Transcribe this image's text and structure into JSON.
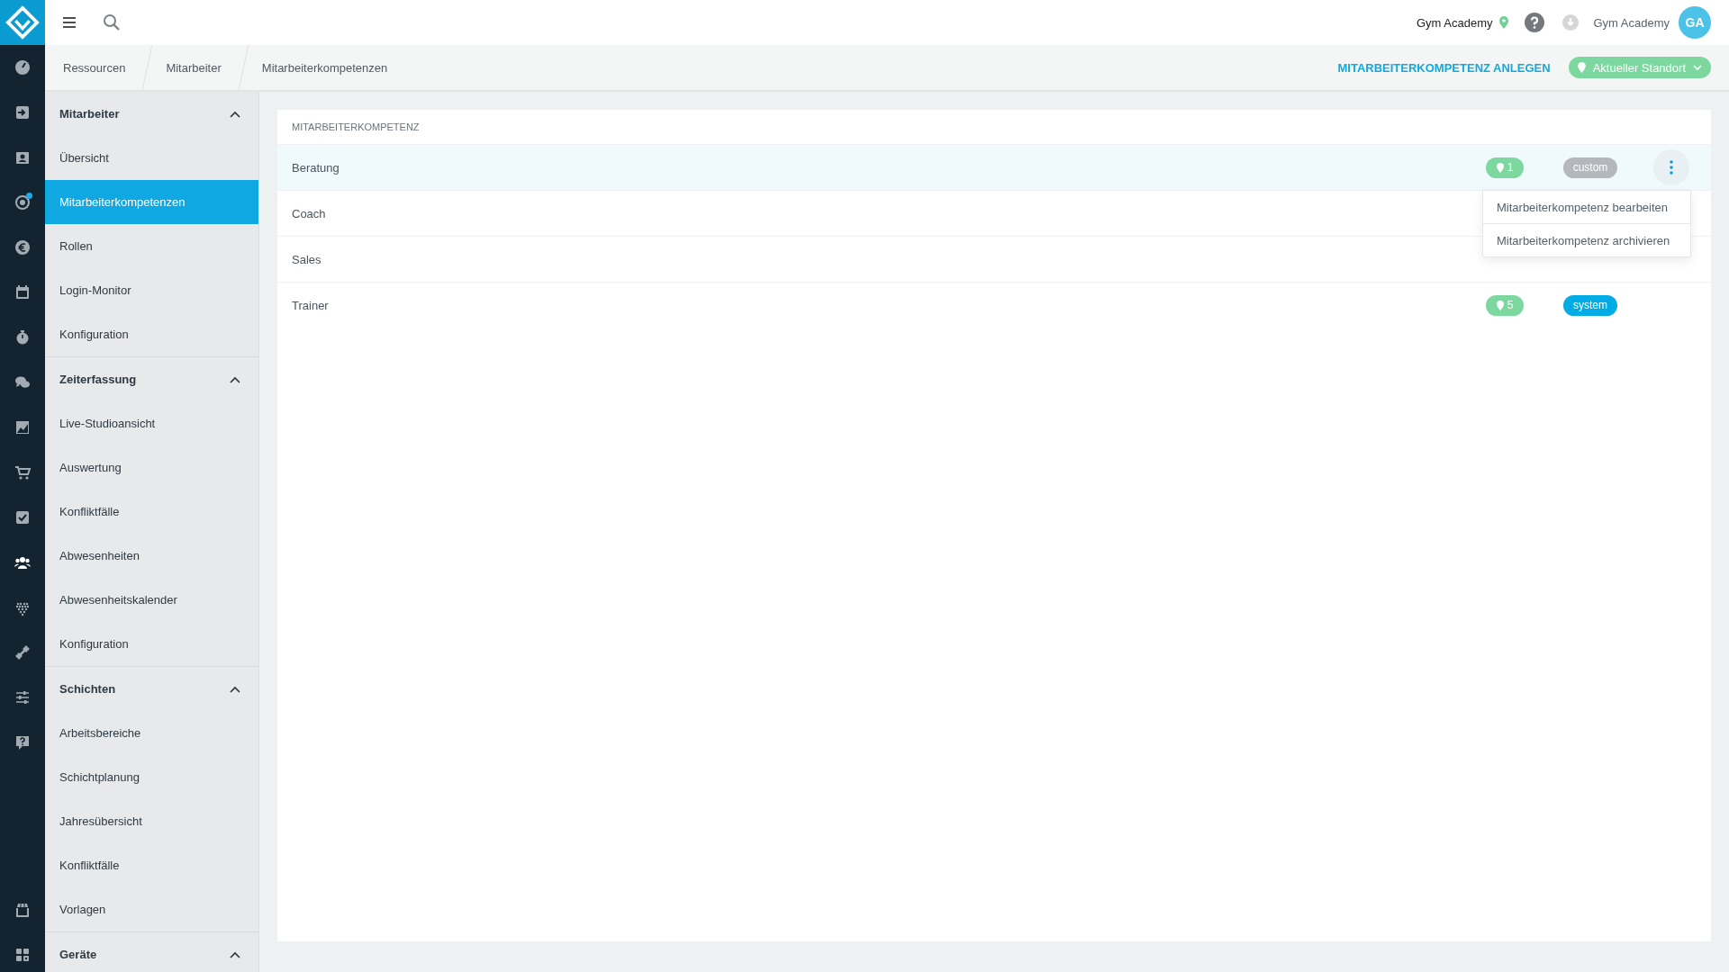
{
  "top_bar": {
    "location": "Gym Academy",
    "user": "Gym Academy",
    "avatar": "GA"
  },
  "nav_rail": [
    {
      "selected": false,
      "notification": false
    },
    {
      "selected": false,
      "notification": false
    },
    {
      "selected": false,
      "notification": false
    },
    {
      "selected": false,
      "notification": true
    },
    {
      "selected": false,
      "notification": false
    },
    {
      "selected": false,
      "notification": false
    },
    {
      "selected": false,
      "notification": false
    },
    {
      "selected": false,
      "notification": false
    },
    {
      "selected": false,
      "notification": false
    },
    {
      "selected": false,
      "notification": false
    },
    {
      "selected": false,
      "notification": false
    },
    {
      "selected": true,
      "notification": false
    },
    {
      "selected": false,
      "notification": false
    },
    {
      "selected": false,
      "notification": false
    },
    {
      "selected": false,
      "notification": false
    },
    {
      "selected": false,
      "notification": false
    }
  ],
  "nav_rail_bottom": [
    {
      "selected": false
    },
    {
      "selected": false
    }
  ],
  "breadcrumbs": [
    "Ressourcen",
    "Mitarbeiter",
    "Mitarbeiterkompetenzen"
  ],
  "actions": {
    "create": "MITARBEITERKOMPETENZ ANLEGEN",
    "location_filter": "Aktueller Standort"
  },
  "sidebar": {
    "sections": [
      {
        "title": "Mitarbeiter",
        "expanded": true,
        "items": [
          {
            "label": "Übersicht",
            "selected": false
          },
          {
            "label": "Mitarbeiterkompetenzen",
            "selected": true
          },
          {
            "label": "Rollen",
            "selected": false
          },
          {
            "label": "Login-Monitor",
            "selected": false
          },
          {
            "label": "Konfiguration",
            "selected": false
          }
        ]
      },
      {
        "title": "Zeiterfassung",
        "expanded": true,
        "items": [
          {
            "label": "Live-Studioansicht",
            "selected": false
          },
          {
            "label": "Auswertung",
            "selected": false
          },
          {
            "label": "Konfliktfälle",
            "selected": false
          },
          {
            "label": "Abwesenheiten",
            "selected": false
          },
          {
            "label": "Abwesenheitskalender",
            "selected": false
          },
          {
            "label": "Konfiguration",
            "selected": false
          }
        ]
      },
      {
        "title": "Schichten",
        "expanded": true,
        "items": [
          {
            "label": "Arbeitsbereiche",
            "selected": false
          },
          {
            "label": "Schichtplanung",
            "selected": false
          },
          {
            "label": "Jahresübersicht",
            "selected": false
          },
          {
            "label": "Konfliktfälle",
            "selected": false
          },
          {
            "label": "Vorlagen",
            "selected": false
          }
        ]
      },
      {
        "title": "Geräte",
        "expanded": true
      }
    ]
  },
  "table": {
    "column_1": "MITARBEITERKOMPETENZ",
    "rows": [
      {
        "name": "Beratung",
        "highlighted": true,
        "locations": "1",
        "type": {
          "label": "custom",
          "color": "#b4b7bc"
        },
        "menu": [
          "Mitarbeiterkompetenz bearbeiten",
          "Mitarbeiterkompetenz archivieren"
        ]
      },
      {
        "name": "Coach",
        "highlighted": false
      },
      {
        "name": "Sales",
        "highlighted": false
      },
      {
        "name": "Trainer",
        "highlighted": false,
        "locations": "5",
        "type": {
          "label": "system",
          "color": "#00ace6"
        }
      }
    ]
  }
}
